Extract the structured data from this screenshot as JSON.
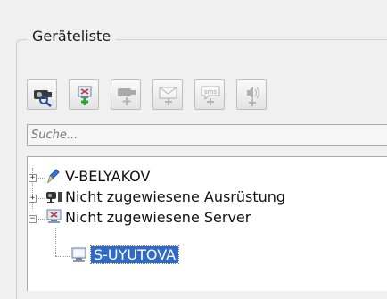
{
  "panel": {
    "title": "Geräteliste"
  },
  "toolbar": {
    "buttons": [
      {
        "icon": "search-camera-icon",
        "enabled": true
      },
      {
        "icon": "add-server-icon",
        "enabled": true
      },
      {
        "icon": "add-camera-icon",
        "enabled": false
      },
      {
        "icon": "add-mail-icon",
        "enabled": false
      },
      {
        "icon": "add-sms-icon",
        "enabled": false
      },
      {
        "icon": "add-sound-icon",
        "enabled": false
      }
    ]
  },
  "search": {
    "placeholder": "Suche..."
  },
  "tree": {
    "items": [
      {
        "label": "V-BELYAKOV",
        "icon": "pencil-icon",
        "expander": "+"
      },
      {
        "label": "Nicht zugewiesene Ausrüstung",
        "icon": "equipment-icon",
        "expander": "+"
      },
      {
        "label": "Nicht zugewiesene Server",
        "icon": "server-error-icon",
        "expander": "−"
      },
      {
        "label": "S-UYUTOVA",
        "icon": "computer-icon",
        "selected": true
      }
    ]
  },
  "colors": {
    "selection": "#316ac5",
    "accent_green": "#2aa12a"
  }
}
